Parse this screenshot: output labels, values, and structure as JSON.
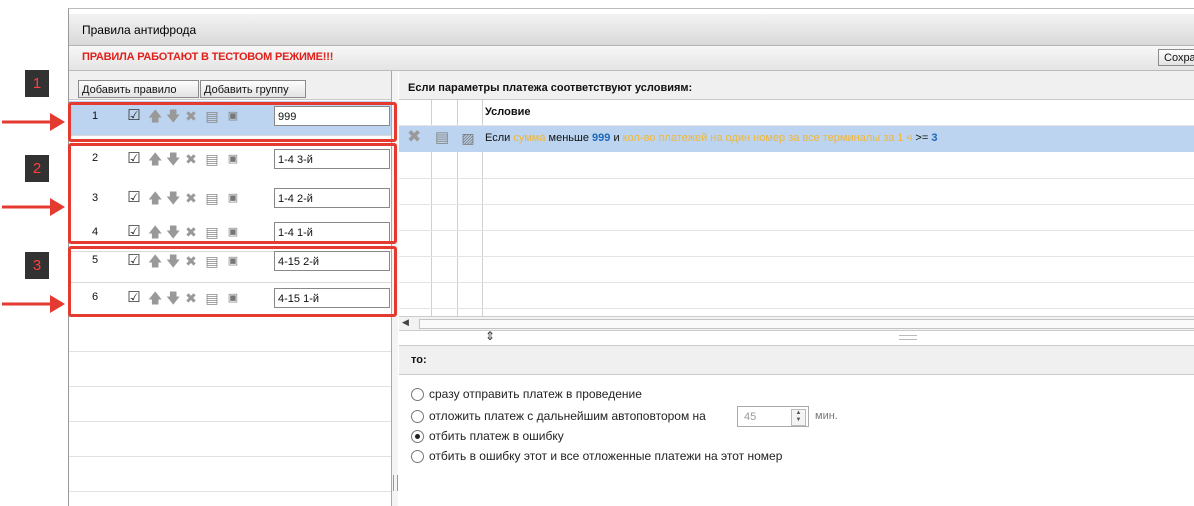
{
  "window": {
    "title": "Правила антифрода"
  },
  "warning": {
    "text": "ПРАВИЛА РАБОТАЮТ В ТЕСТОВОМ РЕЖИМЕ!!!",
    "save_label": "Сохра"
  },
  "left_toolbar": {
    "add_rule": "Добавить правило",
    "add_group": "Добавить группу"
  },
  "rules": [
    {
      "num": "1",
      "name": "999",
      "selected": true
    },
    {
      "num": "2",
      "name": "1-4 3-й"
    },
    {
      "num": "3",
      "name": "1-4 2-й"
    },
    {
      "num": "4",
      "name": "1-4 1-й"
    },
    {
      "num": "5",
      "name": "4-15 2-й"
    },
    {
      "num": "6",
      "name": "4-15 1-й"
    }
  ],
  "conditions": {
    "header": "Если параметры платежа соответствуют условиям:",
    "column": "Условие",
    "row": {
      "prefix": "Если",
      "field1": "сумма",
      "op1": "меньше",
      "value1": "999",
      "conj": "и",
      "field2": "кол-во платежей на один номер за все терминалы за 1 ч",
      "op2": ">=",
      "value2": "3"
    }
  },
  "then": {
    "label": "то:",
    "options": [
      {
        "label": "сразу отправить платеж в проведение",
        "checked": false
      },
      {
        "label": "отложить платеж с дальнейшим автоповтором на",
        "checked": false
      },
      {
        "label": "отбить платеж в ошибку",
        "checked": true
      },
      {
        "label": "отбить в ошибку этот и все отложенные платежи на этот номер",
        "checked": false
      }
    ],
    "delay_value": "45",
    "delay_unit": "мин."
  },
  "annotations": [
    "1",
    "2",
    "3"
  ],
  "colors": {
    "warning": "#e0201a",
    "selected_row": "#bcd4ef",
    "annotation": "#e53a2f",
    "value_blue": "#1d68b8",
    "field_yellow": "#f0b73a"
  }
}
